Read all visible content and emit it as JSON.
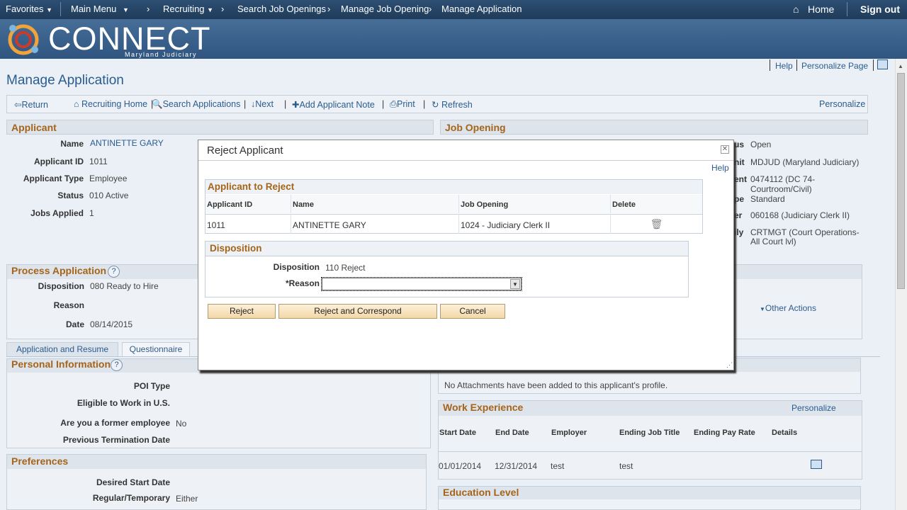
{
  "nav": {
    "favorites": "Favorites",
    "main_menu": "Main Menu",
    "recruiting": "Recruiting",
    "search_job_openings": "Search Job Openings",
    "manage_job_opening": "Manage Job Opening",
    "manage_application": "Manage Application",
    "home": "Home",
    "sign_out": "Sign out"
  },
  "brand": {
    "name": "CONNECT",
    "sub": "Maryland Judiciary"
  },
  "page": {
    "title": "Manage Application",
    "help": "Help",
    "personalize_page": "Personalize Page",
    "personalize": "Personalize"
  },
  "toolbar": {
    "return": "Return",
    "recruiting_home": "Recruiting Home",
    "search_applications": "Search Applications",
    "next": "Next",
    "add_note": "Add Applicant Note",
    "print": "Print",
    "refresh": "Refresh"
  },
  "applicant": {
    "header": "Applicant",
    "name_label": "Name",
    "name": "ANTINETTE GARY",
    "id_label": "Applicant ID",
    "id": "1011",
    "type_label": "Applicant Type",
    "type": "Employee",
    "status_label": "Status",
    "status": "010 Active",
    "jobs_label": "Jobs Applied",
    "jobs": "1"
  },
  "job_opening": {
    "header": "Job Opening",
    "status_label_frag": "us",
    "status": "Open",
    "unit_label_frag": "nit",
    "unit": "MDJUD (Maryland Judiciary)",
    "dept_label_frag": "ent",
    "dept_1": "0474112 (DC 74-",
    "dept_2": "Courtroom/Civil)",
    "type_label_frag": "pe",
    "type": "Standard",
    "pos_label_frag": "er",
    "position": "060168 (Judiciary Clerk II)",
    "family_label_frag": "ily",
    "family_1": "CRTMGT (Court Operations-",
    "family_2": "All Court lvl)"
  },
  "process": {
    "header": "Process Application",
    "disposition_label": "Disposition",
    "disposition": "080 Ready to Hire",
    "reason_label": "Reason",
    "date_label": "Date",
    "date": "08/14/2015",
    "other_actions": "Other Actions"
  },
  "tabs": {
    "app_resume": "Application and Resume",
    "questionnaire": "Questionnaire"
  },
  "personal": {
    "header": "Personal Information",
    "poi_label": "POI Type",
    "eligible_label": "Eligible to Work in U.S.",
    "former_label": "Are you a former employee",
    "former": "No",
    "prev_term_label": "Previous Termination Date"
  },
  "preferences": {
    "header": "Preferences",
    "start_label": "Desired Start Date",
    "regtemp_label": "Regular/Temporary",
    "regtemp": "Either"
  },
  "attachments": {
    "text": "No Attachments have been added to this applicant's profile."
  },
  "work": {
    "header": "Work Experience",
    "personalize": "Personalize",
    "columns": [
      "Start Date",
      "End Date",
      "Employer",
      "Ending Job Title",
      "Ending Pay Rate",
      "Details"
    ],
    "row": [
      "01/01/2014",
      "12/31/2014",
      "test",
      "test",
      "",
      ""
    ]
  },
  "education": {
    "header": "Education Level"
  },
  "modal": {
    "title": "Reject Applicant",
    "help": "Help",
    "grid_header": "Applicant to Reject",
    "columns": [
      "Applicant ID",
      "Name",
      "Job Opening",
      "Delete"
    ],
    "row": [
      "1011",
      "ANTINETTE GARY",
      "1024 - Judiciary Clerk II"
    ],
    "disp_header": "Disposition",
    "disp_label": "Disposition",
    "disp_value": "110 Reject",
    "reason_label": "*Reason",
    "reason_value": "",
    "btn_reject": "Reject",
    "btn_reject_correspond": "Reject and Correspond",
    "btn_cancel": "Cancel"
  },
  "colors": {
    "accent_orange": "#a56418",
    "link_blue": "#2a5c8f",
    "header_navy": "#1f3b59"
  }
}
